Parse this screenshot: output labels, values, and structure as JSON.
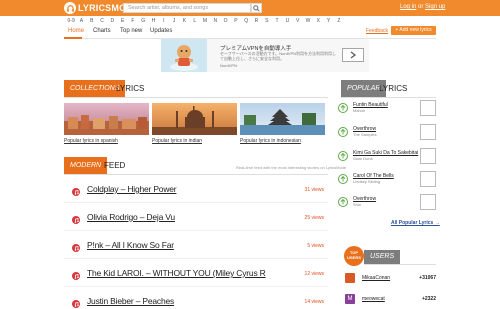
{
  "header": {
    "logo_text": "LYRICSMODE",
    "search_placeholder": "Search artist, albums, and songs",
    "login_label": "Log in",
    "or_label": "or",
    "signup_label": "Sign up",
    "color_accent": "#f08a2c"
  },
  "alphabet": [
    "0-9",
    "A",
    "B",
    "C",
    "D",
    "E",
    "F",
    "G",
    "H",
    "I",
    "J",
    "K",
    "L",
    "M",
    "N",
    "O",
    "P",
    "Q",
    "R",
    "S",
    "T",
    "U",
    "V",
    "W",
    "X",
    "Y",
    "Z"
  ],
  "nav": {
    "items": [
      "Home",
      "Charts",
      "Top new",
      "Updates"
    ],
    "feedback": "Feedback",
    "add_button": "+  Add new lyrics"
  },
  "ad": {
    "title": "プレミアムVPNを自動導入手",
    "description": "セーフサーバースの活動方です。NordVPN利用を方法利用利用して自動上位し、さらに安全な利用。",
    "brand": "NordVPN"
  },
  "collections": {
    "tag": "COLLECTIONS",
    "label": "LYRICS",
    "items": [
      {
        "label": "Popular lyrics in spanish"
      },
      {
        "label": "Popular lyrics in indian"
      },
      {
        "label": "Popular lyrics in indonesian"
      }
    ]
  },
  "feed": {
    "tag": "MODERN",
    "label": "FEED",
    "description": "Real-time feed with the most interesting stories on LyricsMode",
    "items": [
      {
        "title": "Coldplay – Higher Power",
        "views": "31 views"
      },
      {
        "title": "Olivia Rodrigo – Deja Vu",
        "views": "25 views"
      },
      {
        "title": "P!nk – All I Know So Far",
        "views": "5 views"
      },
      {
        "title": "The Kid LAROI. – WITHOUT YOU (Miley Cyrus R",
        "views": "12 views"
      },
      {
        "title": "Justin Bieber – Peaches",
        "views": "14 views"
      }
    ]
  },
  "popular": {
    "tag": "POPULAR",
    "label": "LYRICS",
    "items": [
      {
        "title": "Funtin Beautiful",
        "artist": "Mahoh"
      },
      {
        "title": "Overthrow",
        "artist": "The Samples"
      },
      {
        "title": "Kimi Ga Suki Da To Sakebitai",
        "artist": "Slam Dunk"
      },
      {
        "title": "Carol Of The Bells",
        "artist": "Lindsey Stirling"
      },
      {
        "title": "Overthrow",
        "artist": "Shlo"
      }
    ],
    "all_link": "All Popular Lyrics →"
  },
  "users": {
    "badge": "TOP USERS",
    "label": "USERS",
    "items": [
      {
        "name": "MikaaConan",
        "score": "+31067"
      },
      {
        "name": "meowecat",
        "score": "+2322"
      }
    ]
  }
}
